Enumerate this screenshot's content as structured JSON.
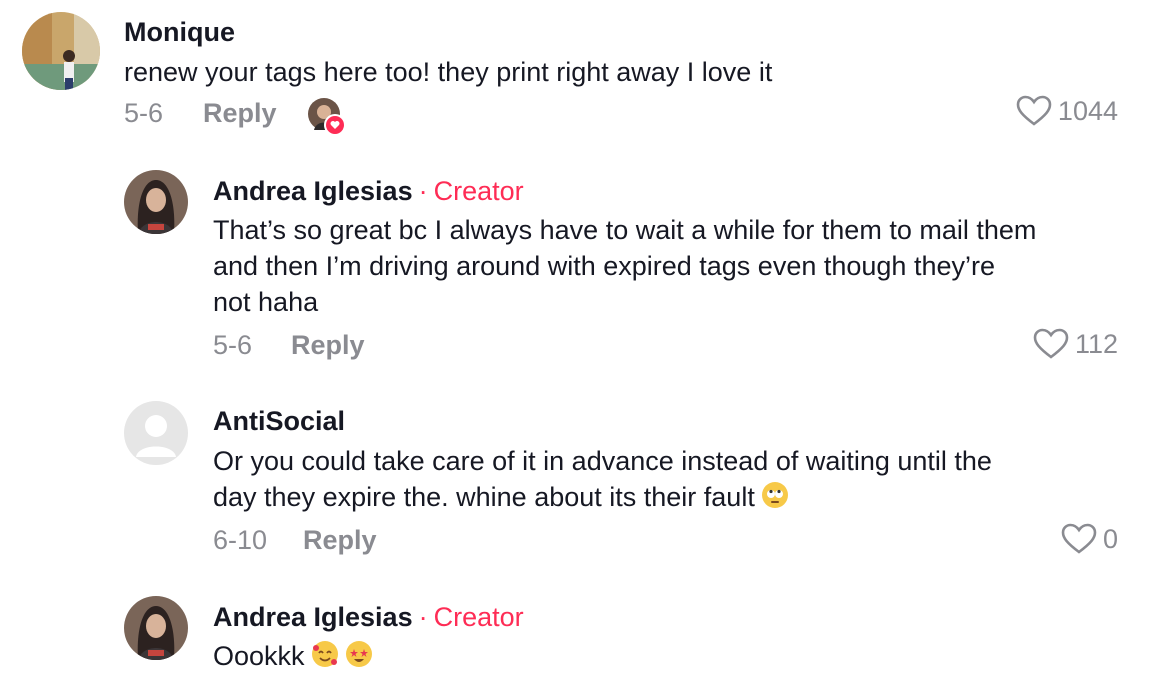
{
  "comments": [
    {
      "author": "Monique",
      "text": "renew your tags here too! they print right away I love it",
      "date": "5-6",
      "reply_label": "Reply",
      "likes": "1044",
      "avatar_icon": "avatar-photo-canal"
    },
    {
      "author": "Andrea Iglesias",
      "badge_sep": "·",
      "badge": "Creator",
      "text_lines": [
        "That’s so great bc I always have to wait a while for them to mail them",
        "and then I’m driving around with expired tags even though they’re",
        "not haha"
      ],
      "date": "5-6",
      "reply_label": "Reply",
      "likes": "112",
      "avatar_icon": "avatar-photo-woman"
    },
    {
      "author": "AntiSocial",
      "text_lines": [
        "Or you could take care of it in advance instead of waiting until the",
        "day they expire the. whine about its their fault"
      ],
      "emoji_icon": "face-with-rolling-eyes-emoji",
      "date": "6-10",
      "reply_label": "Reply",
      "likes": "0",
      "avatar_icon": "default-avatar-icon"
    },
    {
      "author": "Andrea Iglesias",
      "badge_sep": "·",
      "badge": "Creator",
      "text": "Oookkk",
      "emoji_icons": [
        "smiling-face-with-hearts-emoji",
        "star-struck-emoji"
      ],
      "avatar_icon": "avatar-photo-woman"
    }
  ],
  "colors": {
    "text": "#161823",
    "secondary": "#8a8b91",
    "creator": "#fe2c55"
  }
}
